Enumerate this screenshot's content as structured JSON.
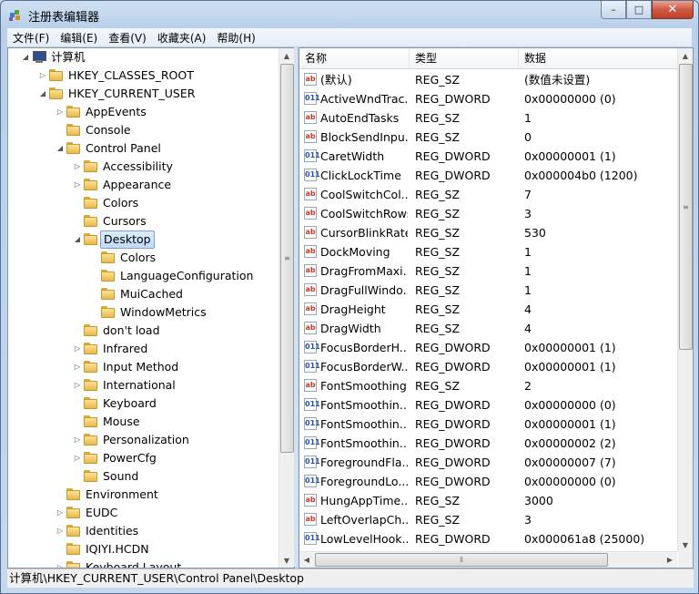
{
  "window": {
    "title": "注册表编辑器",
    "minimize": "–",
    "maximize": "□",
    "close": "✕"
  },
  "menu": [
    "文件(F)",
    "编辑(E)",
    "查看(V)",
    "收藏夹(A)",
    "帮助(H)"
  ],
  "tree": [
    {
      "label": "计算机",
      "level": 0,
      "expander": "expanded",
      "icon": "computer-icon"
    },
    {
      "label": "HKEY_CLASSES_ROOT",
      "level": 1,
      "expander": "collapsed"
    },
    {
      "label": "HKEY_CURRENT_USER",
      "level": 1,
      "expander": "expanded"
    },
    {
      "label": "AppEvents",
      "level": 2,
      "expander": "collapsed"
    },
    {
      "label": "Console",
      "level": 2,
      "expander": "none"
    },
    {
      "label": "Control Panel",
      "level": 2,
      "expander": "expanded"
    },
    {
      "label": "Accessibility",
      "level": 3,
      "expander": "collapsed"
    },
    {
      "label": "Appearance",
      "level": 3,
      "expander": "collapsed"
    },
    {
      "label": "Colors",
      "level": 3,
      "expander": "none"
    },
    {
      "label": "Cursors",
      "level": 3,
      "expander": "none"
    },
    {
      "label": "Desktop",
      "level": 3,
      "expander": "expanded",
      "selected": true
    },
    {
      "label": "Colors",
      "level": 4,
      "expander": "none"
    },
    {
      "label": "LanguageConfiguration",
      "level": 4,
      "expander": "none"
    },
    {
      "label": "MuiCached",
      "level": 4,
      "expander": "none"
    },
    {
      "label": "WindowMetrics",
      "level": 4,
      "expander": "none"
    },
    {
      "label": "don't load",
      "level": 3,
      "expander": "none"
    },
    {
      "label": "Infrared",
      "level": 3,
      "expander": "collapsed"
    },
    {
      "label": "Input Method",
      "level": 3,
      "expander": "collapsed"
    },
    {
      "label": "International",
      "level": 3,
      "expander": "collapsed"
    },
    {
      "label": "Keyboard",
      "level": 3,
      "expander": "none"
    },
    {
      "label": "Mouse",
      "level": 3,
      "expander": "none"
    },
    {
      "label": "Personalization",
      "level": 3,
      "expander": "collapsed"
    },
    {
      "label": "PowerCfg",
      "level": 3,
      "expander": "collapsed"
    },
    {
      "label": "Sound",
      "level": 3,
      "expander": "none"
    },
    {
      "label": "Environment",
      "level": 2,
      "expander": "none"
    },
    {
      "label": "EUDC",
      "level": 2,
      "expander": "collapsed"
    },
    {
      "label": "Identities",
      "level": 2,
      "expander": "collapsed"
    },
    {
      "label": "IQIYI.HCDN",
      "level": 2,
      "expander": "none"
    },
    {
      "label": "Keyboard Layout",
      "level": 2,
      "expander": "collapsed"
    }
  ],
  "list": {
    "columns": [
      "名称",
      "类型",
      "数据"
    ],
    "rows": [
      {
        "name": "(默认)",
        "type": "REG_SZ",
        "data": "(数值未设置)",
        "icon": "sz"
      },
      {
        "name": "ActiveWndTrac...",
        "type": "REG_DWORD",
        "data": "0x00000000 (0)",
        "icon": "dw"
      },
      {
        "name": "AutoEndTasks",
        "type": "REG_SZ",
        "data": "1",
        "icon": "sz"
      },
      {
        "name": "BlockSendInpu...",
        "type": "REG_SZ",
        "data": "0",
        "icon": "sz"
      },
      {
        "name": "CaretWidth",
        "type": "REG_DWORD",
        "data": "0x00000001 (1)",
        "icon": "dw"
      },
      {
        "name": "ClickLockTime",
        "type": "REG_DWORD",
        "data": "0x000004b0 (1200)",
        "icon": "dw"
      },
      {
        "name": "CoolSwitchCol...",
        "type": "REG_SZ",
        "data": "7",
        "icon": "sz"
      },
      {
        "name": "CoolSwitchRows",
        "type": "REG_SZ",
        "data": "3",
        "icon": "sz"
      },
      {
        "name": "CursorBlinkRate",
        "type": "REG_SZ",
        "data": "530",
        "icon": "sz"
      },
      {
        "name": "DockMoving",
        "type": "REG_SZ",
        "data": "1",
        "icon": "sz"
      },
      {
        "name": "DragFromMaxi...",
        "type": "REG_SZ",
        "data": "1",
        "icon": "sz"
      },
      {
        "name": "DragFullWindo...",
        "type": "REG_SZ",
        "data": "1",
        "icon": "sz"
      },
      {
        "name": "DragHeight",
        "type": "REG_SZ",
        "data": "4",
        "icon": "sz"
      },
      {
        "name": "DragWidth",
        "type": "REG_SZ",
        "data": "4",
        "icon": "sz"
      },
      {
        "name": "FocusBorderH...",
        "type": "REG_DWORD",
        "data": "0x00000001 (1)",
        "icon": "dw"
      },
      {
        "name": "FocusBorderW...",
        "type": "REG_DWORD",
        "data": "0x00000001 (1)",
        "icon": "dw"
      },
      {
        "name": "FontSmoothing",
        "type": "REG_SZ",
        "data": "2",
        "icon": "sz"
      },
      {
        "name": "FontSmoothin...",
        "type": "REG_DWORD",
        "data": "0x00000000 (0)",
        "icon": "dw"
      },
      {
        "name": "FontSmoothin...",
        "type": "REG_DWORD",
        "data": "0x00000001 (1)",
        "icon": "dw"
      },
      {
        "name": "FontSmoothin...",
        "type": "REG_DWORD",
        "data": "0x00000002 (2)",
        "icon": "dw"
      },
      {
        "name": "ForegroundFla...",
        "type": "REG_DWORD",
        "data": "0x00000007 (7)",
        "icon": "dw"
      },
      {
        "name": "ForegroundLo...",
        "type": "REG_DWORD",
        "data": "0x00000000 (0)",
        "icon": "dw"
      },
      {
        "name": "HungAppTime...",
        "type": "REG_SZ",
        "data": "3000",
        "icon": "sz"
      },
      {
        "name": "LeftOverlapCh...",
        "type": "REG_SZ",
        "data": "3",
        "icon": "sz"
      },
      {
        "name": "LowLevelHook...",
        "type": "REG_DWORD",
        "data": "0x000061a8 (25000)",
        "icon": "dw"
      }
    ]
  },
  "icons": {
    "sz": "ab",
    "dw": "011"
  },
  "status": "计算机\\HKEY_CURRENT_USER\\Control Panel\\Desktop"
}
